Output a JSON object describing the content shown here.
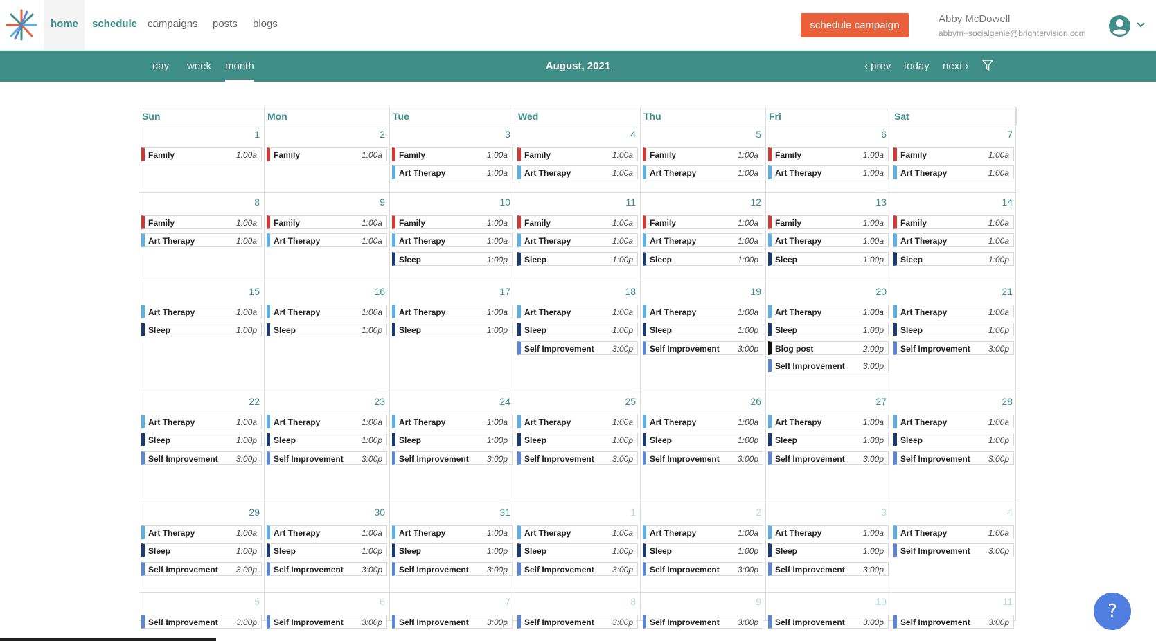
{
  "nav": {
    "links": [
      "home",
      "schedule",
      "campaigns",
      "posts",
      "blogs"
    ],
    "schedule_button": "schedule campaign",
    "user_name": "Abby McDowell",
    "user_email": "abbym+socialgenie@brightervision.com"
  },
  "subnav": {
    "views": [
      "day",
      "week",
      "month"
    ],
    "active_view": "month",
    "month_title": "August, 2021",
    "prev": "‹ prev",
    "today": "today",
    "next": "next ›"
  },
  "colors": {
    "brand": "#3e8d87",
    "accent": "#e9603b",
    "help": "#4f7ee0",
    "event_colors": {
      "Family": "#d13a34",
      "Art Therapy": "#5cb0e4",
      "Sleep": "#1d3a6e",
      "Self Improvement": "#5b86d6",
      "Blog post": "#111111"
    }
  },
  "calendar": {
    "days_of_week": [
      "Sun",
      "Mon",
      "Tue",
      "Wed",
      "Thu",
      "Fri",
      "Sat"
    ],
    "weeks": [
      {
        "days": [
          {
            "num": "1",
            "other": false,
            "events": [
              {
                "title": "Family",
                "time": "1:00a"
              }
            ]
          },
          {
            "num": "2",
            "other": false,
            "events": [
              {
                "title": "Family",
                "time": "1:00a"
              }
            ]
          },
          {
            "num": "3",
            "other": false,
            "events": [
              {
                "title": "Family",
                "time": "1:00a"
              },
              {
                "title": "Art Therapy",
                "time": "1:00a"
              }
            ]
          },
          {
            "num": "4",
            "other": false,
            "events": [
              {
                "title": "Family",
                "time": "1:00a"
              },
              {
                "title": "Art Therapy",
                "time": "1:00a"
              }
            ]
          },
          {
            "num": "5",
            "other": false,
            "events": [
              {
                "title": "Family",
                "time": "1:00a"
              },
              {
                "title": "Art Therapy",
                "time": "1:00a"
              }
            ]
          },
          {
            "num": "6",
            "other": false,
            "events": [
              {
                "title": "Family",
                "time": "1:00a"
              },
              {
                "title": "Art Therapy",
                "time": "1:00a"
              }
            ]
          },
          {
            "num": "7",
            "other": false,
            "events": [
              {
                "title": "Family",
                "time": "1:00a"
              },
              {
                "title": "Art Therapy",
                "time": "1:00a"
              }
            ]
          }
        ]
      },
      {
        "days": [
          {
            "num": "8",
            "other": false,
            "events": [
              {
                "title": "Family",
                "time": "1:00a"
              },
              {
                "title": "Art Therapy",
                "time": "1:00a"
              }
            ]
          },
          {
            "num": "9",
            "other": false,
            "events": [
              {
                "title": "Family",
                "time": "1:00a"
              },
              {
                "title": "Art Therapy",
                "time": "1:00a"
              }
            ]
          },
          {
            "num": "10",
            "other": false,
            "events": [
              {
                "title": "Family",
                "time": "1:00a"
              },
              {
                "title": "Art Therapy",
                "time": "1:00a"
              },
              {
                "title": "Sleep",
                "time": "1:00p"
              }
            ]
          },
          {
            "num": "11",
            "other": false,
            "events": [
              {
                "title": "Family",
                "time": "1:00a"
              },
              {
                "title": "Art Therapy",
                "time": "1:00a"
              },
              {
                "title": "Sleep",
                "time": "1:00p"
              }
            ]
          },
          {
            "num": "12",
            "other": false,
            "events": [
              {
                "title": "Family",
                "time": "1:00a"
              },
              {
                "title": "Art Therapy",
                "time": "1:00a"
              },
              {
                "title": "Sleep",
                "time": "1:00p"
              }
            ]
          },
          {
            "num": "13",
            "other": false,
            "events": [
              {
                "title": "Family",
                "time": "1:00a"
              },
              {
                "title": "Art Therapy",
                "time": "1:00a"
              },
              {
                "title": "Sleep",
                "time": "1:00p"
              }
            ]
          },
          {
            "num": "14",
            "other": false,
            "events": [
              {
                "title": "Family",
                "time": "1:00a"
              },
              {
                "title": "Art Therapy",
                "time": "1:00a"
              },
              {
                "title": "Sleep",
                "time": "1:00p"
              }
            ]
          }
        ]
      },
      {
        "days": [
          {
            "num": "15",
            "other": false,
            "events": [
              {
                "title": "Art Therapy",
                "time": "1:00a"
              },
              {
                "title": "Sleep",
                "time": "1:00p"
              }
            ]
          },
          {
            "num": "16",
            "other": false,
            "events": [
              {
                "title": "Art Therapy",
                "time": "1:00a"
              },
              {
                "title": "Sleep",
                "time": "1:00p"
              }
            ]
          },
          {
            "num": "17",
            "other": false,
            "events": [
              {
                "title": "Art Therapy",
                "time": "1:00a"
              },
              {
                "title": "Sleep",
                "time": "1:00p"
              }
            ]
          },
          {
            "num": "18",
            "other": false,
            "events": [
              {
                "title": "Art Therapy",
                "time": "1:00a"
              },
              {
                "title": "Sleep",
                "time": "1:00p"
              },
              {
                "title": "Self Improvement",
                "time": "3:00p"
              }
            ]
          },
          {
            "num": "19",
            "other": false,
            "events": [
              {
                "title": "Art Therapy",
                "time": "1:00a"
              },
              {
                "title": "Sleep",
                "time": "1:00p"
              },
              {
                "title": "Self Improvement",
                "time": "3:00p"
              }
            ]
          },
          {
            "num": "20",
            "other": false,
            "events": [
              {
                "title": "Art Therapy",
                "time": "1:00a"
              },
              {
                "title": "Sleep",
                "time": "1:00p"
              },
              {
                "title": "Blog post",
                "time": "2:00p"
              },
              {
                "title": "Self Improvement",
                "time": "3:00p"
              }
            ]
          },
          {
            "num": "21",
            "other": false,
            "events": [
              {
                "title": "Art Therapy",
                "time": "1:00a"
              },
              {
                "title": "Sleep",
                "time": "1:00p"
              },
              {
                "title": "Self Improvement",
                "time": "3:00p"
              }
            ]
          }
        ]
      },
      {
        "days": [
          {
            "num": "22",
            "other": false,
            "events": [
              {
                "title": "Art Therapy",
                "time": "1:00a"
              },
              {
                "title": "Sleep",
                "time": "1:00p"
              },
              {
                "title": "Self Improvement",
                "time": "3:00p"
              }
            ]
          },
          {
            "num": "23",
            "other": false,
            "events": [
              {
                "title": "Art Therapy",
                "time": "1:00a"
              },
              {
                "title": "Sleep",
                "time": "1:00p"
              },
              {
                "title": "Self Improvement",
                "time": "3:00p"
              }
            ]
          },
          {
            "num": "24",
            "other": false,
            "events": [
              {
                "title": "Art Therapy",
                "time": "1:00a"
              },
              {
                "title": "Sleep",
                "time": "1:00p"
              },
              {
                "title": "Self Improvement",
                "time": "3:00p"
              }
            ]
          },
          {
            "num": "25",
            "other": false,
            "events": [
              {
                "title": "Art Therapy",
                "time": "1:00a"
              },
              {
                "title": "Sleep",
                "time": "1:00p"
              },
              {
                "title": "Self Improvement",
                "time": "3:00p"
              }
            ]
          },
          {
            "num": "26",
            "other": false,
            "events": [
              {
                "title": "Art Therapy",
                "time": "1:00a"
              },
              {
                "title": "Sleep",
                "time": "1:00p"
              },
              {
                "title": "Self Improvement",
                "time": "3:00p"
              }
            ]
          },
          {
            "num": "27",
            "other": false,
            "events": [
              {
                "title": "Art Therapy",
                "time": "1:00a"
              },
              {
                "title": "Sleep",
                "time": "1:00p"
              },
              {
                "title": "Self Improvement",
                "time": "3:00p"
              }
            ]
          },
          {
            "num": "28",
            "other": false,
            "events": [
              {
                "title": "Art Therapy",
                "time": "1:00a"
              },
              {
                "title": "Sleep",
                "time": "1:00p"
              },
              {
                "title": "Self Improvement",
                "time": "3:00p"
              }
            ]
          }
        ]
      },
      {
        "days": [
          {
            "num": "29",
            "other": false,
            "events": [
              {
                "title": "Art Therapy",
                "time": "1:00a"
              },
              {
                "title": "Sleep",
                "time": "1:00p"
              },
              {
                "title": "Self Improvement",
                "time": "3:00p"
              }
            ]
          },
          {
            "num": "30",
            "other": false,
            "events": [
              {
                "title": "Art Therapy",
                "time": "1:00a"
              },
              {
                "title": "Sleep",
                "time": "1:00p"
              },
              {
                "title": "Self Improvement",
                "time": "3:00p"
              }
            ]
          },
          {
            "num": "31",
            "other": false,
            "events": [
              {
                "title": "Art Therapy",
                "time": "1:00a"
              },
              {
                "title": "Sleep",
                "time": "1:00p"
              },
              {
                "title": "Self Improvement",
                "time": "3:00p"
              }
            ]
          },
          {
            "num": "1",
            "other": true,
            "events": [
              {
                "title": "Art Therapy",
                "time": "1:00a"
              },
              {
                "title": "Sleep",
                "time": "1:00p"
              },
              {
                "title": "Self Improvement",
                "time": "3:00p"
              }
            ]
          },
          {
            "num": "2",
            "other": true,
            "events": [
              {
                "title": "Art Therapy",
                "time": "1:00a"
              },
              {
                "title": "Sleep",
                "time": "1:00p"
              },
              {
                "title": "Self Improvement",
                "time": "3:00p"
              }
            ]
          },
          {
            "num": "3",
            "other": true,
            "events": [
              {
                "title": "Art Therapy",
                "time": "1:00a"
              },
              {
                "title": "Sleep",
                "time": "1:00p"
              },
              {
                "title": "Self Improvement",
                "time": "3:00p"
              }
            ]
          },
          {
            "num": "4",
            "other": true,
            "events": [
              {
                "title": "Art Therapy",
                "time": "1:00a"
              },
              {
                "title": "Self Improvement",
                "time": "3:00p"
              }
            ]
          }
        ]
      },
      {
        "days": [
          {
            "num": "5",
            "other": true,
            "events": [
              {
                "title": "Self Improvement",
                "time": "3:00p"
              }
            ]
          },
          {
            "num": "6",
            "other": true,
            "events": [
              {
                "title": "Self Improvement",
                "time": "3:00p"
              }
            ]
          },
          {
            "num": "7",
            "other": true,
            "events": [
              {
                "title": "Self Improvement",
                "time": "3:00p"
              }
            ]
          },
          {
            "num": "8",
            "other": true,
            "events": [
              {
                "title": "Self Improvement",
                "time": "3:00p"
              }
            ]
          },
          {
            "num": "9",
            "other": true,
            "events": [
              {
                "title": "Self Improvement",
                "time": "3:00p"
              }
            ]
          },
          {
            "num": "10",
            "other": true,
            "events": [
              {
                "title": "Self Improvement",
                "time": "3:00p"
              }
            ]
          },
          {
            "num": "11",
            "other": true,
            "events": [
              {
                "title": "Self Improvement",
                "time": "3:00p"
              }
            ]
          }
        ]
      }
    ]
  },
  "help_label": "?"
}
